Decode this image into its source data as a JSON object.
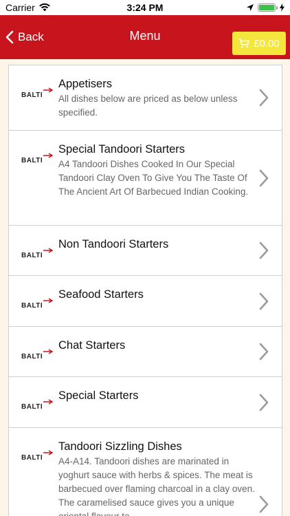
{
  "status_bar": {
    "carrier": "Carrier",
    "time": "3:24 PM"
  },
  "nav": {
    "back_label": "Back",
    "title": "Menu",
    "cart_total": "£0.00"
  },
  "colors": {
    "nav_background": "#c8141c",
    "cart_button": "#f4e63c",
    "page_background": "#fdf6e8"
  },
  "logo_text": "BALTI",
  "menu": [
    {
      "title": "Appetisers",
      "description": "All dishes below are priced as below unless specified."
    },
    {
      "title": "Special Tandoori Starters",
      "description": "A4 Tandoori Dishes Cooked In Our Special Tandoori Clay Oven To Give You The Taste Of The Ancient Art Of Barbecued Indian Cooking."
    },
    {
      "title": "Non Tandoori Starters",
      "description": ""
    },
    {
      "title": "Seafood Starters",
      "description": ""
    },
    {
      "title": "Chat Starters",
      "description": ""
    },
    {
      "title": "Special Starters",
      "description": ""
    },
    {
      "title": "Tandoori Sizzling Dishes",
      "description": "A4-A14. Tandoori dishes are marinated in yoghurt sauce with herbs & spices. The meat is barbecued over flaming charcoal in a clay oven. The caramelised sauce gives you a unique oriental flavour to"
    }
  ]
}
